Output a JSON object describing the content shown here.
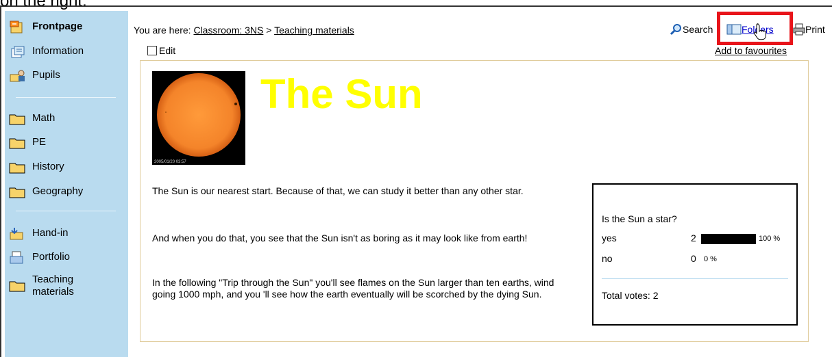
{
  "caption": "on the right.",
  "header": {
    "breadcrumb_prefix": "You are here: ",
    "breadcrumb_link1": "Classroom: 3NS",
    "breadcrumb_sep": " > ",
    "breadcrumb_link2": "Teaching materials",
    "edit_label": "Edit",
    "search_label": "Search",
    "folders_label": "Folders",
    "print_label": "Print",
    "favourites_label": "Add to favourites"
  },
  "sidebar": {
    "items": [
      {
        "label": "Frontpage",
        "icon": "frontpage-icon"
      },
      {
        "label": "Information",
        "icon": "information-icon"
      },
      {
        "label": "Pupils",
        "icon": "pupils-icon"
      },
      {
        "label": "Math",
        "icon": "folder-icon"
      },
      {
        "label": "PE",
        "icon": "folder-icon"
      },
      {
        "label": "History",
        "icon": "folder-icon"
      },
      {
        "label": "Geography",
        "icon": "folder-icon"
      },
      {
        "label": "Hand-in",
        "icon": "hand-in-icon"
      },
      {
        "label": "Portfolio",
        "icon": "portfolio-icon"
      },
      {
        "label": "Teaching materials",
        "icon": "folder-icon"
      }
    ]
  },
  "article": {
    "title": "The Sun",
    "image_caption": "2005/01/20 03:57",
    "paragraphs": [
      "The Sun is our nearest start. Because of that, we can study it better than any other star.",
      "And when you do that, you see that the Sun isn't as boring as it may look like from earth!",
      "In the following \"Trip through the Sun\" you'll see flames on the Sun larger than ten earths, wind going 1000 mph, and you 'll see  how the earth eventually will be scorched by the dying Sun."
    ]
  },
  "poll": {
    "question": "Is the Sun a star?",
    "options": [
      {
        "label": "yes",
        "count": "2",
        "percent": "100 %",
        "fraction": 1.0
      },
      {
        "label": "no",
        "count": "0",
        "percent": "0 %",
        "fraction": 0.0
      }
    ],
    "total": "Total votes: 2"
  },
  "colors": {
    "sidebar": "#b9dbef",
    "title": "#ffff00",
    "highlight": "#e8141a",
    "link": "#0000cc",
    "sun": "#f4842a"
  }
}
